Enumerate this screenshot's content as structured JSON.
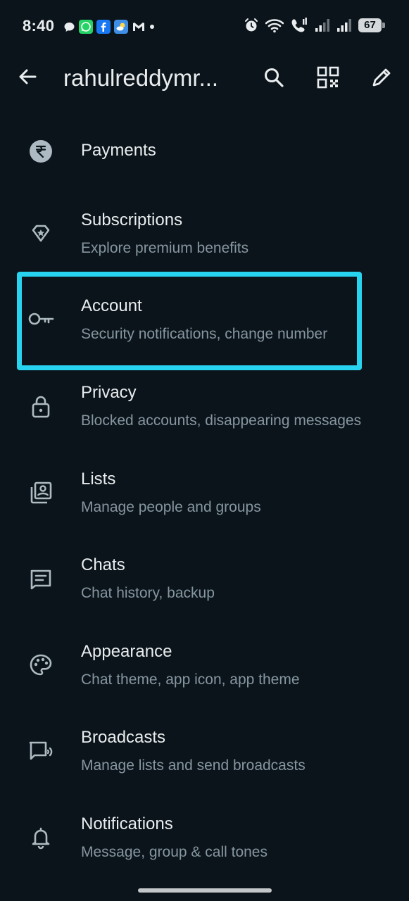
{
  "status_bar": {
    "time": "8:40",
    "notification_icons": [
      "chat-bubble-icon",
      "whatsapp-icon",
      "facebook-icon",
      "weather-icon",
      "gmail-icon",
      "more-dot-icon"
    ],
    "system_icons": [
      "alarm-icon",
      "wifi-icon",
      "volte-call-icon",
      "signal-icon",
      "signal-icon"
    ],
    "battery_level": "67"
  },
  "header": {
    "title": "rahulreddymr...",
    "actions": [
      "search-icon",
      "qr-code-icon",
      "edit-pencil-icon"
    ]
  },
  "settings": [
    {
      "id": "payments",
      "icon": "rupee-icon",
      "title": "Payments",
      "subtitle": ""
    },
    {
      "id": "subscriptions",
      "icon": "diamond-star-icon",
      "title": "Subscriptions",
      "subtitle": "Explore premium benefits"
    },
    {
      "id": "account",
      "icon": "key-icon",
      "title": "Account",
      "subtitle": "Security notifications, change number",
      "highlighted": true
    },
    {
      "id": "privacy",
      "icon": "lock-icon",
      "title": "Privacy",
      "subtitle": "Blocked accounts, disappearing messages"
    },
    {
      "id": "lists",
      "icon": "contact-list-icon",
      "title": "Lists",
      "subtitle": "Manage people and groups"
    },
    {
      "id": "chats",
      "icon": "chat-icon",
      "title": "Chats",
      "subtitle": "Chat history, backup"
    },
    {
      "id": "appearance",
      "icon": "palette-icon",
      "title": "Appearance",
      "subtitle": "Chat theme, app icon, app theme"
    },
    {
      "id": "broadcasts",
      "icon": "broadcast-icon",
      "title": "Broadcasts",
      "subtitle": "Manage lists and send broadcasts"
    },
    {
      "id": "notifications",
      "icon": "bell-icon",
      "title": "Notifications",
      "subtitle": "Message, group & call tones"
    }
  ],
  "colors": {
    "background": "#0b141a",
    "primary_text": "#e9edef",
    "secondary_text": "#8696a0",
    "icon": "#aebac1",
    "highlight_border": "#27d3ee"
  }
}
